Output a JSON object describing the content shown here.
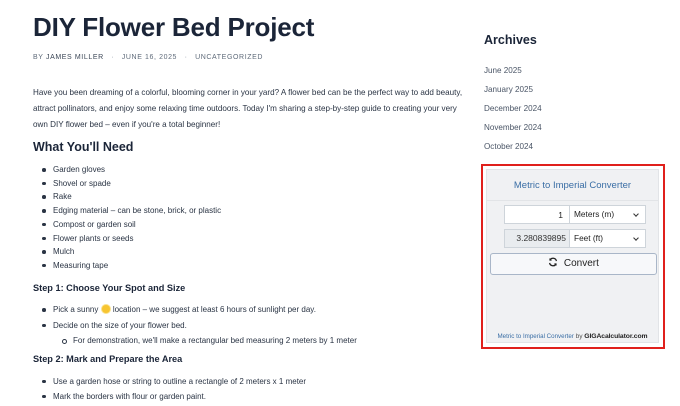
{
  "post": {
    "title": "DIY Flower Bed Project",
    "meta": {
      "by": "BY",
      "author": "JAMES MILLER",
      "date": "JUNE 16, 2025",
      "category": "UNCATEGORIZED"
    },
    "intro": "Have you been dreaming of a colorful, blooming corner in your yard? A flower bed can be the perfect way to add beauty, attract pollinators, and enjoy some relaxing time outdoors. Today I'm sharing a step-by-step guide to creating your very own DIY flower bed – even if you're a total beginner!",
    "need_heading": "What You'll Need",
    "needs": [
      "Garden gloves",
      "Shovel or spade",
      "Rake",
      "Edging material – can be stone, brick, or plastic",
      "Compost or garden soil",
      "Flower plants or seeds",
      "Mulch",
      "Measuring tape"
    ],
    "step1": {
      "heading": "Step 1: Choose Your Spot and Size",
      "item1_before": "Pick a sunny",
      "item1_after": "location – we suggest at least 6 hours of sunlight per day.",
      "item2": "Decide on the size of your flower bed.",
      "sub1": "For demonstration, we'll make a rectangular bed measuring 2 meters by 1 meter"
    },
    "step2": {
      "heading": "Step 2: Mark and Prepare the Area",
      "items": [
        "Use a garden hose or string to outline a rectangle of 2 meters x 1 meter",
        "Mark the borders with flour or garden paint."
      ]
    }
  },
  "sidebar": {
    "archives_title": "Archives",
    "archives": [
      "June 2025",
      "January 2025",
      "December 2024",
      "November 2024",
      "October 2024"
    ]
  },
  "widget": {
    "title": "Metric to Imperial Converter",
    "input_value": "1",
    "input_unit": "Meters (m)",
    "result_value": "3.280839895",
    "result_unit": "Feet (ft)",
    "convert_label": "Convert",
    "credit_link": "Metric to Imperial Converter",
    "credit_by": "by",
    "credit_brand": "GIGAcalculator.com"
  },
  "colors": {
    "highlight_border": "#e0201c",
    "link_blue": "#3a6ea5",
    "heading": "#1b2538"
  }
}
